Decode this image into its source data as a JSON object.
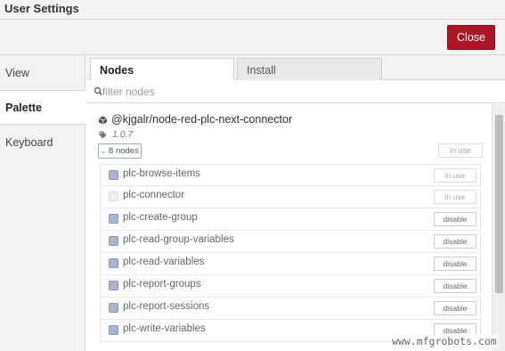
{
  "dialog": {
    "title": "User Settings",
    "close_label": "Close"
  },
  "sidebar": {
    "items": [
      {
        "label": "View",
        "active": false
      },
      {
        "label": "Palette",
        "active": true
      },
      {
        "label": "Keyboard",
        "active": false
      }
    ]
  },
  "tabs": [
    {
      "label": "Nodes",
      "active": true
    },
    {
      "label": "Install",
      "active": false
    }
  ],
  "filter": {
    "placeholder": "filter nodes",
    "value": ""
  },
  "package": {
    "name": "@kjgalr/node-red-plc-next-connector",
    "version": "1.0.7",
    "nodes_toggle": "8 nodes",
    "status": "in use"
  },
  "nodes": [
    {
      "name": "plc-browse-items",
      "action": "in use"
    },
    {
      "name": "plc-connector",
      "action": "in use"
    },
    {
      "name": "plc-create-group",
      "action": "disable"
    },
    {
      "name": "plc-read-group-variables",
      "action": "disable"
    },
    {
      "name": "plc-read-variables",
      "action": "disable"
    },
    {
      "name": "plc-report-groups",
      "action": "disable"
    },
    {
      "name": "plc-report-sessions",
      "action": "disable"
    },
    {
      "name": "plc-write-variables",
      "action": "disable"
    }
  ],
  "watermark": "www.mfgrobots.com",
  "colors": {
    "close_button": "#ad1625",
    "node_swatch": "#a8b5cb"
  },
  "icons": {
    "search": "search-icon",
    "package": "cube-icon",
    "version": "tag-icon",
    "expand": "chevron-down-icon"
  }
}
